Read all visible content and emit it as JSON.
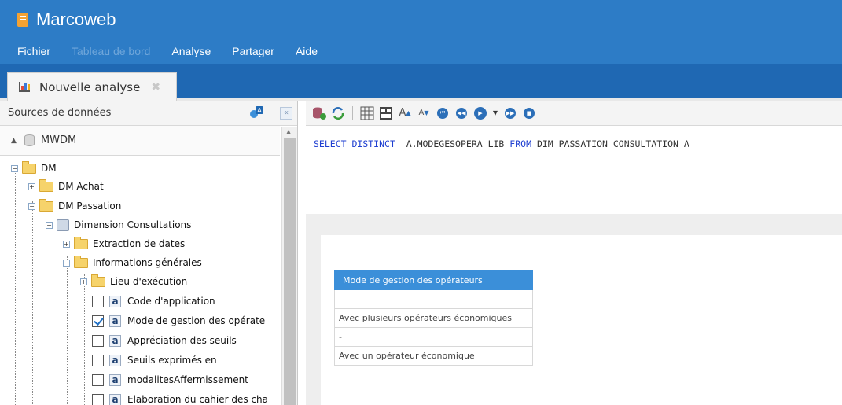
{
  "app": {
    "title": "Marcoweb",
    "brand_color": "#2d7cc6",
    "logo_icon": "orange-book-icon"
  },
  "menu": [
    {
      "label": "Fichier",
      "disabled": false
    },
    {
      "label": "Tableau de bord",
      "disabled": true
    },
    {
      "label": "Analyse",
      "disabled": false
    },
    {
      "label": "Partager",
      "disabled": false
    },
    {
      "label": "Aide",
      "disabled": false
    }
  ],
  "tab": {
    "label": "Nouvelle analyse",
    "icon": "bar-chart-icon",
    "close_icon": "close-icon"
  },
  "sources": {
    "title": "Sources de données",
    "database": "MWDM"
  },
  "tree": {
    "dm": "DM",
    "dm_achat": "DM Achat",
    "dm_passation": "DM Passation",
    "dimension_consultations": "Dimension Consultations",
    "extraction_dates": "Extraction de dates",
    "informations_generales": "Informations générales",
    "lieu_execution": "Lieu d'exécution",
    "attributes": [
      {
        "label": "Code d'application",
        "checked": false
      },
      {
        "label": "Mode de gestion des opérate",
        "checked": true
      },
      {
        "label": "Appréciation des seuils",
        "checked": false
      },
      {
        "label": "Seuils exprimés en",
        "checked": false
      },
      {
        "label": "modalitesAffermissement",
        "checked": false
      },
      {
        "label": "Elaboration du cahier des cha",
        "checked": false
      }
    ],
    "attribute_icon_letter": "a"
  },
  "query": {
    "kw_select": "SELECT",
    "kw_distinct": "DISTINCT",
    "column": "A.MODEGESOPERA_LIB",
    "kw_from": "FROM",
    "table": "DIM_PASSATION_CONSULTATION A"
  },
  "results": {
    "header": "Mode de gestion des opérateurs",
    "rows": [
      "",
      "Avec plusieurs opérateurs économiques",
      "-",
      "Avec un opérateur économique"
    ]
  }
}
